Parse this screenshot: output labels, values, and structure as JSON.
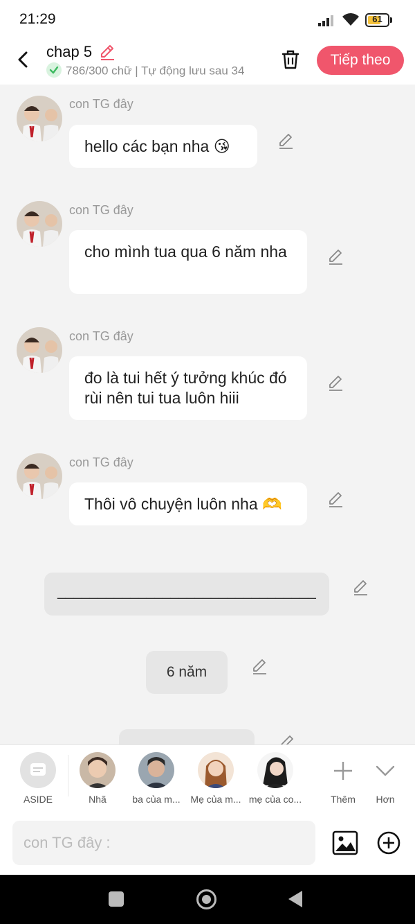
{
  "status_bar": {
    "time": "21:29",
    "battery": "61",
    "battery_level": 0.61
  },
  "header": {
    "title": "chap 5",
    "word_count": "786/300 chữ | Tự động lưu sau 34",
    "next_button": "Tiếp theo"
  },
  "messages": [
    {
      "sender": "con TG đây",
      "text": "hello các bạn nha 😘"
    },
    {
      "sender": "con TG đây",
      "text": "cho mình tua qua 6 năm nha"
    },
    {
      "sender": "con TG đây",
      "text": "đo là tui hết ý tưởng khúc đó rùi nên tui tua luôn hiii"
    },
    {
      "sender": "con TG đây",
      "text": "Thôi vô chuyện luôn nha 🫶"
    }
  ],
  "narrations": [
    {
      "text": "________________________________"
    },
    {
      "text": "6 năm"
    }
  ],
  "characters": [
    {
      "label": "ASIDE",
      "icon": "aside-chat-icon"
    },
    {
      "label": "Nhã",
      "icon": "avatar-nha"
    },
    {
      "label": "ba của m...",
      "icon": "avatar-ba"
    },
    {
      "label": "Mẹ của m...",
      "icon": "avatar-me"
    },
    {
      "label": "mẹ của co...",
      "icon": "avatar-me-co"
    }
  ],
  "actions": {
    "more_label": "Thêm",
    "collapse_label": "Hơn"
  },
  "input": {
    "placeholder": "con TG đây :"
  },
  "colors": {
    "accent": "#f0566c",
    "check": "#3cba5f"
  }
}
